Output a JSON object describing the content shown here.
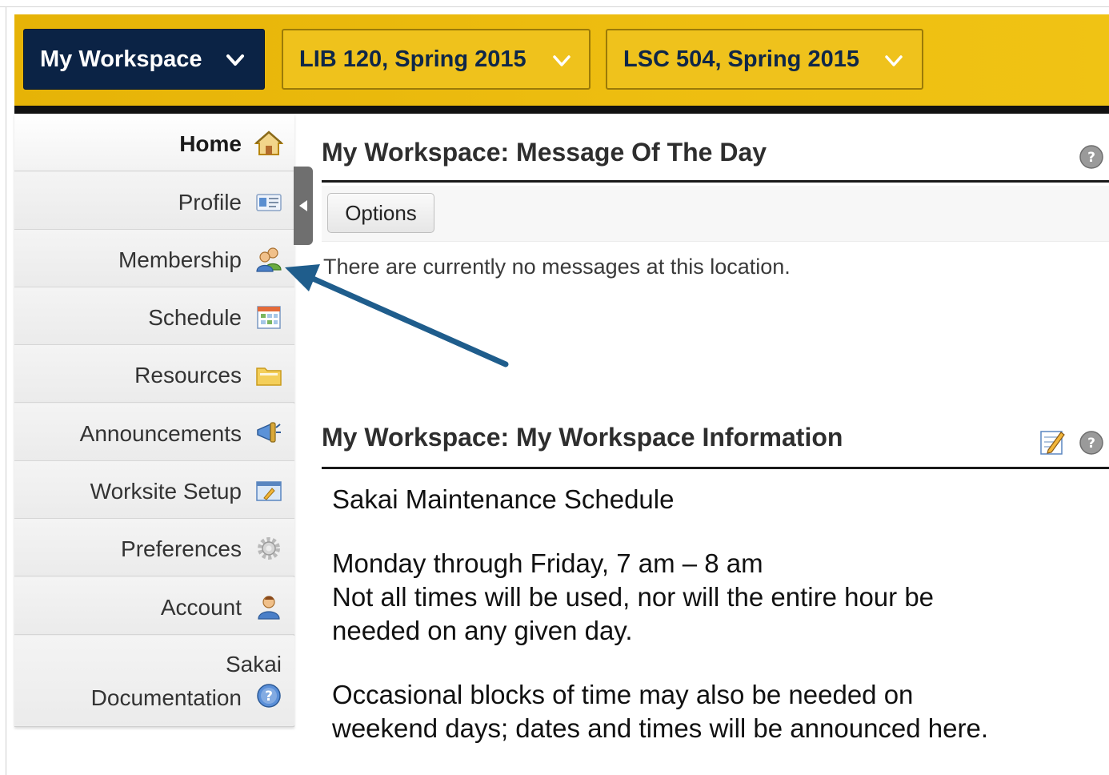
{
  "header": {
    "site_tabs": [
      {
        "label": "My Workspace",
        "state": "current"
      },
      {
        "label": "LIB 120, Spring 2015"
      },
      {
        "label": "LSC 504, Spring 2015"
      }
    ],
    "colors": {
      "bar": "#e9b70a",
      "current_tab": "#0b2345",
      "tab_text": "#0f2748"
    }
  },
  "sidebar": {
    "items": [
      {
        "label": "Home",
        "icon": "home-icon",
        "active": true
      },
      {
        "label": "Profile",
        "icon": "profile-card-icon"
      },
      {
        "label": "Membership",
        "icon": "membership-icon"
      },
      {
        "label": "Schedule",
        "icon": "calendar-icon"
      },
      {
        "label": "Resources",
        "icon": "folder-icon"
      },
      {
        "label": "Announcements",
        "icon": "megaphone-icon"
      },
      {
        "label": "Worksite Setup",
        "icon": "worksite-setup-icon"
      },
      {
        "label": "Preferences",
        "icon": "gear-icon"
      },
      {
        "label": "Account",
        "icon": "user-icon"
      },
      {
        "label_line1": "Sakai",
        "label_line2": "Documentation",
        "icon": "help-circle-icon"
      }
    ]
  },
  "main": {
    "motd": {
      "title": "My Workspace: Message Of The Day",
      "options_label": "Options",
      "message": "There are currently no messages at this location."
    },
    "info": {
      "title": "My Workspace: My Workspace Information",
      "heading": "Sakai Maintenance Schedule",
      "line1": "Monday through Friday, 7 am – 8 am",
      "line2": "Not all times will be used, nor will the entire hour be",
      "line3": "needed on any given day.",
      "line4": "Occasional blocks of time may also be needed on",
      "line5": "weekend days; dates and times will be announced here."
    }
  },
  "annotation": {
    "arrow_target": "Membership",
    "color": "#1f5d8c"
  }
}
